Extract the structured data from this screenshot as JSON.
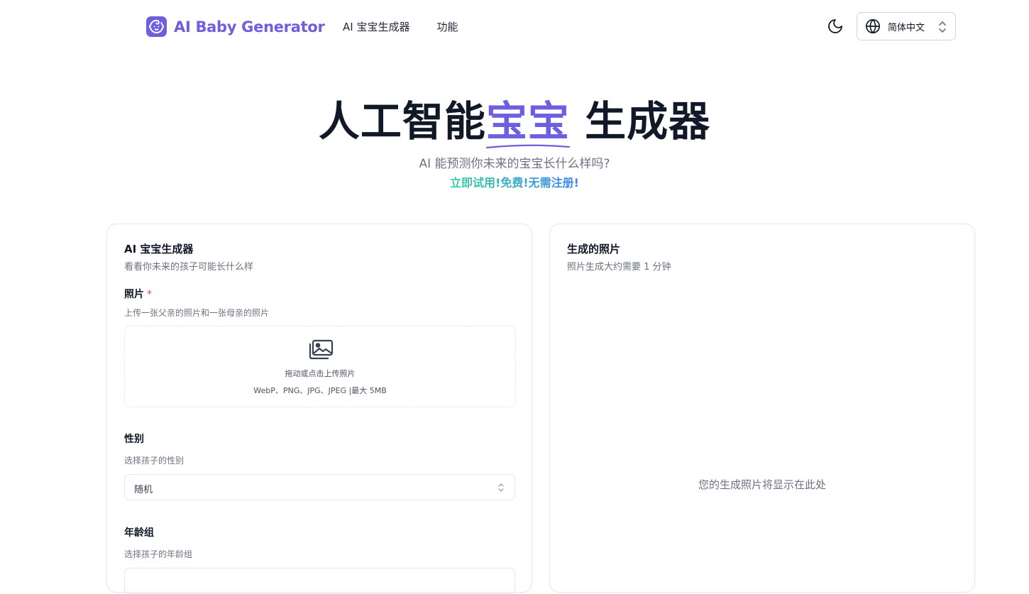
{
  "header": {
    "logo_text": "AI Baby Generator",
    "nav": [
      "AI 宝宝生成器",
      "功能"
    ],
    "language": "简体中文"
  },
  "hero": {
    "title_part1": "人工智能",
    "title_accent": "宝宝",
    "title_part2": " 生成器",
    "subtitle": "AI 能预测你未来的宝宝长什么样吗?",
    "cta": "立即试用!免费!无需注册!"
  },
  "generator_card": {
    "title": "AI 宝宝生成器",
    "description": "看看你未来的孩子可能长什么样",
    "photo": {
      "label": "照片",
      "required_mark": "*",
      "help": "上传一张父亲的照片和一张母亲的照片",
      "drop_text": "拖动或点击上传照片",
      "formats": "WebP、PNG、JPG、JPEG |最大 5MB"
    },
    "gender": {
      "label": "性别",
      "help": "选择孩子的性别",
      "value": "随机"
    },
    "age_group": {
      "label": "年龄组",
      "help": "选择孩子的年龄组"
    }
  },
  "result_card": {
    "title": "生成的照片",
    "description": "照片生成大约需要 1 分钟",
    "placeholder": "您的生成照片将显示在此处"
  },
  "colors": {
    "brand": "#6d5fe0",
    "cta_gradient_start": "#34d399",
    "cta_gradient_end": "#3b82f6",
    "required": "#ef4444"
  }
}
